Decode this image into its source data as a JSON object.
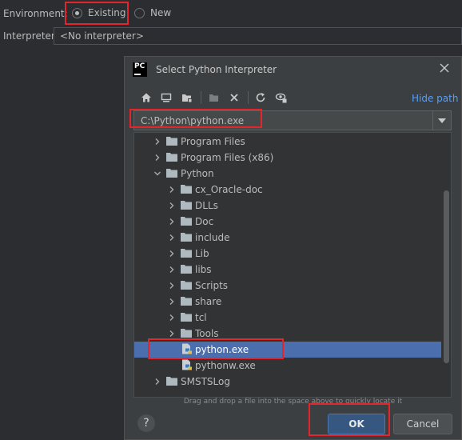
{
  "settings": {
    "environment_label": "Environment:",
    "existing_label": "Existing",
    "new_label": "New",
    "interpreter_label": "Interpreter:",
    "interpreter_value": "<No interpreter>"
  },
  "dialog": {
    "title": "Select Python Interpreter",
    "hide_path_label": "Hide path",
    "path_value": "C:\\Python\\python.exe",
    "hint": "Drag and drop a file into the space above to quickly locate it",
    "ok_label": "OK",
    "cancel_label": "Cancel",
    "help_label": "?"
  },
  "toolbar": {
    "icons": [
      "home-icon",
      "desktop-icon",
      "project-folder-icon",
      "new-folder-icon",
      "delete-icon",
      "refresh-icon",
      "show-hidden-icon"
    ]
  },
  "tree": {
    "items": [
      {
        "label": "Program Files",
        "expanded": false
      },
      {
        "label": "Program Files (x86)",
        "expanded": false
      },
      {
        "label": "Python",
        "expanded": true
      },
      {
        "label": "cx_Oracle-doc",
        "expanded": false
      },
      {
        "label": "DLLs",
        "expanded": false
      },
      {
        "label": "Doc",
        "expanded": false
      },
      {
        "label": "include",
        "expanded": false
      },
      {
        "label": "Lib",
        "expanded": false
      },
      {
        "label": "libs",
        "expanded": false
      },
      {
        "label": "Scripts",
        "expanded": false
      },
      {
        "label": "share",
        "expanded": false
      },
      {
        "label": "tcl",
        "expanded": false
      },
      {
        "label": "Tools",
        "expanded": false
      },
      {
        "label": "python.exe",
        "selected": true
      },
      {
        "label": "pythonw.exe",
        "selected": false
      },
      {
        "label": "SMSTSLog",
        "expanded": false
      }
    ]
  },
  "colors": {
    "background": "#2b2d30",
    "dialog": "#3c3f41",
    "selection": "#4b6eaf",
    "link": "#589df6",
    "highlight_box": "#e3262b",
    "folder": "#aeb9c0"
  }
}
